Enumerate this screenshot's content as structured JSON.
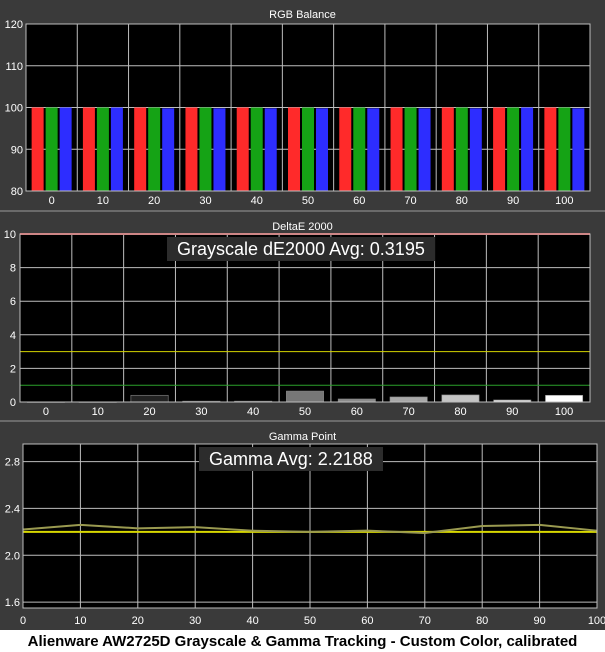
{
  "caption": "Alienware AW2725D Grayscale & Gamma Tracking - Custom Color, calibrated",
  "colors": {
    "background": "#3a3a3a",
    "grid": "#bdbdbd",
    "red": "#ff2a2a",
    "green": "#15a315",
    "blue": "#2d2dff",
    "reference_red": "#e05050",
    "threshold_yellow": "#d4d400",
    "threshold_green": "#2aa02a",
    "gamma_measured": "#9a9a50",
    "gamma_target": "#d8d800"
  },
  "chart_data": [
    {
      "type": "bar",
      "title": "RGB Balance",
      "categories": [
        "0",
        "10",
        "20",
        "30",
        "40",
        "50",
        "60",
        "70",
        "80",
        "90",
        "100"
      ],
      "series": [
        {
          "values": [
            100,
            100,
            100,
            100,
            100,
            100,
            100,
            100,
            100,
            100,
            100
          ]
        },
        {
          "values": [
            100,
            100,
            100,
            100,
            100,
            100,
            100,
            100,
            100,
            100,
            100
          ]
        },
        {
          "values": [
            100,
            100,
            99.8,
            99.8,
            99.8,
            99.8,
            99.8,
            99.8,
            99.8,
            100,
            99.8
          ]
        }
      ],
      "ylim": [
        80,
        120
      ],
      "yticks": [
        80,
        90,
        100,
        110,
        120
      ],
      "grid": true
    },
    {
      "type": "bar",
      "title": "DeltaE 2000",
      "annotation": "Grayscale dE2000 Avg: 0.3195",
      "categories": [
        "0",
        "10",
        "20",
        "30",
        "40",
        "50",
        "60",
        "70",
        "80",
        "90",
        "100"
      ],
      "values": [
        0.0,
        0.0,
        0.4,
        0.05,
        0.05,
        0.65,
        0.18,
        0.3,
        0.42,
        0.12,
        0.4
      ],
      "bar_colors": [
        "#151515",
        "#181818",
        "#222222",
        "#2e2e2e",
        "#3d3d3d",
        "#777777",
        "#8c8c8c",
        "#a8a8a8",
        "#c4c4c4",
        "#dedede",
        "#ffffff"
      ],
      "reference_lines": [
        10,
        3,
        1
      ],
      "ylim": [
        0,
        10
      ],
      "yticks": [
        0,
        2,
        4,
        6,
        8,
        10
      ],
      "grid": true
    },
    {
      "type": "line",
      "title": "Gamma Point",
      "annotation": "Gamma Avg: 2.2188",
      "x": [
        0,
        10,
        20,
        30,
        40,
        50,
        60,
        70,
        80,
        90,
        100
      ],
      "measured": [
        2.22,
        2.26,
        2.23,
        2.24,
        2.21,
        2.2,
        2.21,
        2.19,
        2.25,
        2.26,
        2.21
      ],
      "target": [
        2.2,
        2.2,
        2.2,
        2.2,
        2.2,
        2.2,
        2.2,
        2.2,
        2.2,
        2.2,
        2.2
      ],
      "ylim": [
        1.55,
        2.95
      ],
      "yticks": [
        1.6,
        2,
        2.4,
        2.8
      ],
      "xticks": [
        0,
        10,
        20,
        30,
        40,
        50,
        60,
        70,
        80,
        90,
        100
      ],
      "grid": true
    }
  ]
}
